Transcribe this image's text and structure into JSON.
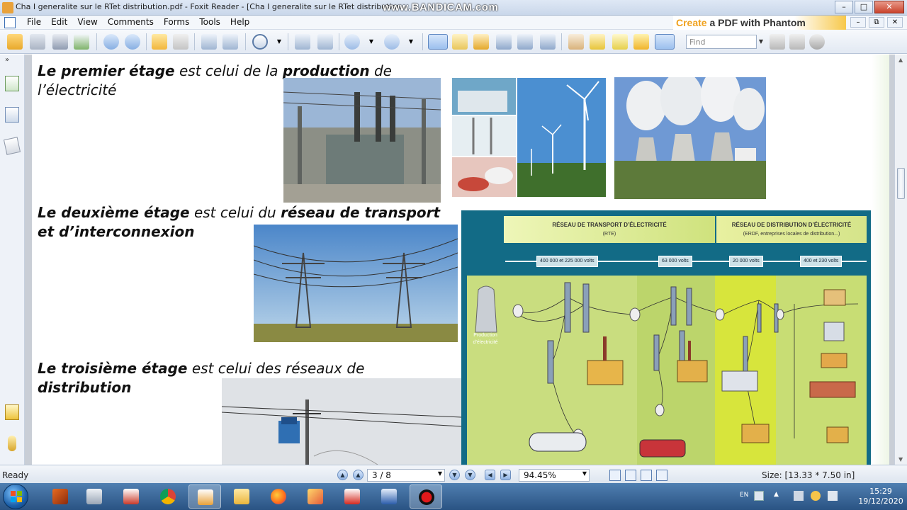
{
  "window": {
    "title": "Cha I generalite sur le RTet distribution.pdf - Foxit Reader - [Cha I generalite sur le RTet distribution",
    "watermark": "www.BANDICAM.com",
    "buttons": [
      "–",
      "□",
      "✕"
    ]
  },
  "menubar": {
    "items": [
      "File",
      "Edit",
      "View",
      "Comments",
      "Forms",
      "Tools",
      "Help"
    ],
    "promo_create": "Create",
    "promo_rest": " a PDF with Phantom",
    "mdi_buttons": [
      "–",
      "⧉",
      "✕"
    ]
  },
  "toolbar": {
    "find_placeholder": "Find"
  },
  "slide": {
    "line1_bold_a": "Le premier étage",
    "line1_mid": " est celui de la ",
    "line1_bold_b": "production",
    "line1_end": " de",
    "line1_cont": "l’électricité",
    "line2_bold_a": "Le deuxième étage",
    "line2_mid": " est celui du ",
    "line2_bold_b": "réseau de transport",
    "line2_cont": "et d’interconnexion",
    "line3_bold_a": "Le troisième étage",
    "line3_mid": " est celui des réseaux de",
    "line3_cont": "distribution"
  },
  "diagram": {
    "transport_title": "RÉSEAU DE TRANSPORT D’ÉLECTRICITÉ",
    "transport_sub": "(RTE)",
    "distribution_title": "RÉSEAU DE DISTRIBUTION D’ÉLECTRICITÉ",
    "distribution_sub": "(ERDF, entreprises locales de distribution...)",
    "voltages": [
      "400 000 et 225 000 volts",
      "63 000 volts",
      "20 000 volts",
      "400 et 230 volts"
    ],
    "production_label": "Production d’électricité"
  },
  "statusbar": {
    "ready": "Ready",
    "page": "3 / 8",
    "zoom": "94.45%",
    "size": "Size: [13.33 * 7.50 in]"
  },
  "taskbar": {
    "lang": "EN",
    "time": "15:29",
    "date": "19/12/2020"
  },
  "colors": {
    "diagram_bg": "#126b86",
    "diagram_field_light": "#c7dc7a",
    "diagram_field_bright": "#d4e53c",
    "taskbar": "#2a5383"
  }
}
